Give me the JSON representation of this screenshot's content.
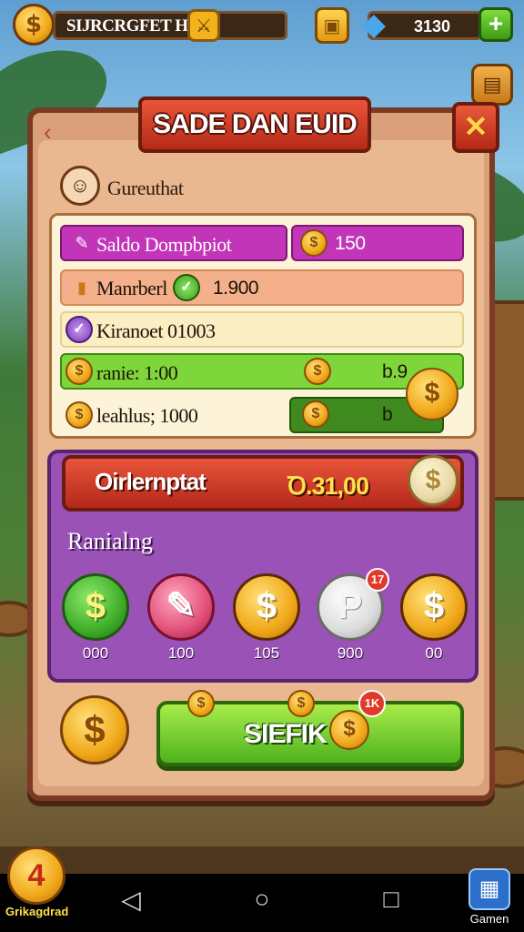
{
  "top_bar": {
    "hub_title": "SIJRCRGFET HUB",
    "gem_count": "3130"
  },
  "dialog": {
    "title": "SADE DAN EUID",
    "close_label": "✕",
    "profile_name": "Gureuthat"
  },
  "stats": [
    {
      "label": "Saldo Dompbpiot",
      "value": "150",
      "color": "#c235b8"
    },
    {
      "label": "Manrberl",
      "value": "1.900",
      "color": "#f3b08a"
    },
    {
      "label": "Kiranoet 01003",
      "value": "",
      "color": "#fbeec3"
    },
    {
      "label": "ranie: 1:00",
      "value": "b.9",
      "color": "#7fd63a"
    },
    {
      "label": "leahlus; 1000",
      "value": "b",
      "color": "#3e8a1e"
    }
  ],
  "total": {
    "label": "Oirlernptat",
    "value": "Ꝺ.31,00"
  },
  "ranking": {
    "title": "Ranialng",
    "items": [
      {
        "icon": "$",
        "value": "000",
        "color": "#3fae2a"
      },
      {
        "icon": "✎",
        "value": "100",
        "color": "#e2507a"
      },
      {
        "icon": "$",
        "value": "105",
        "color": "#f0a718"
      },
      {
        "icon": "P",
        "value": "900",
        "color": "#dcdcdc",
        "badge": "17"
      },
      {
        "icon": "$",
        "value": "00",
        "color": "#f0a718"
      }
    ]
  },
  "action": {
    "label": "SIEFIK",
    "badge": "1K"
  },
  "dock": {
    "left_label": "Grikagdrad",
    "games_label": "Gamen"
  },
  "colors": {
    "panel_border": "#7a3a24",
    "accent_red": "#c4321e",
    "purple": "#9a52b6",
    "green": "#4fb21e",
    "gold": "#f0a718"
  }
}
